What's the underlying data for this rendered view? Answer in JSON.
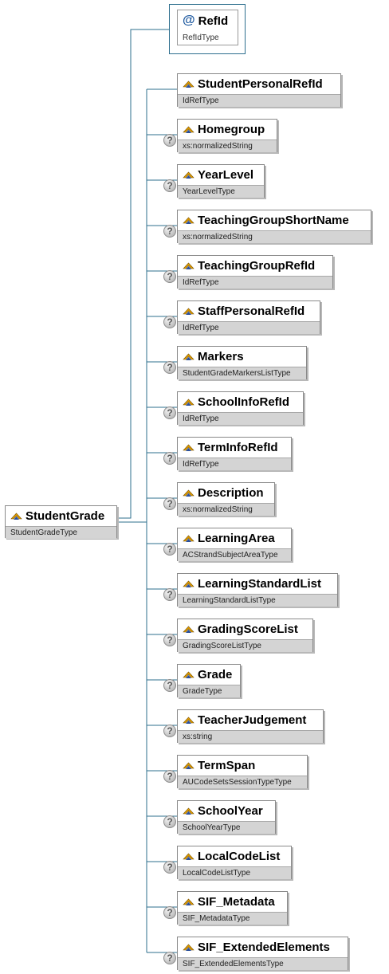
{
  "root": {
    "name": "StudentGrade",
    "type": "StudentGradeType"
  },
  "attribute": {
    "symbol": "@",
    "name": "RefId",
    "type": "RefIdType"
  },
  "optional_icon": "question-mark-icon",
  "element_icon": "element-icon",
  "colors": {
    "connector": "#2e6f8e",
    "type_band": "#d4d4d4",
    "border": "#8a8a8a"
  },
  "elements": [
    {
      "name": "StudentPersonalRefId",
      "type": "IdRefType",
      "optional": false
    },
    {
      "name": "Homegroup",
      "type": "xs:normalizedString",
      "optional": true
    },
    {
      "name": "YearLevel",
      "type": "YearLevelType",
      "optional": true
    },
    {
      "name": "TeachingGroupShortName",
      "type": "xs:normalizedString",
      "optional": true
    },
    {
      "name": "TeachingGroupRefId",
      "type": "IdRefType",
      "optional": true
    },
    {
      "name": "StaffPersonalRefId",
      "type": "IdRefType",
      "optional": true
    },
    {
      "name": "Markers",
      "type": "StudentGradeMarkersListType",
      "optional": true
    },
    {
      "name": "SchoolInfoRefId",
      "type": "IdRefType",
      "optional": true
    },
    {
      "name": "TermInfoRefId",
      "type": "IdRefType",
      "optional": true
    },
    {
      "name": "Description",
      "type": "xs:normalizedString",
      "optional": true
    },
    {
      "name": "LearningArea",
      "type": "ACStrandSubjectAreaType",
      "optional": true
    },
    {
      "name": "LearningStandardList",
      "type": "LearningStandardListType",
      "optional": true
    },
    {
      "name": "GradingScoreList",
      "type": "GradingScoreListType",
      "optional": true
    },
    {
      "name": "Grade",
      "type": "GradeType",
      "optional": true
    },
    {
      "name": "TeacherJudgement",
      "type": "xs:string",
      "optional": true
    },
    {
      "name": "TermSpan",
      "type": "AUCodeSetsSessionTypeType",
      "optional": true
    },
    {
      "name": "SchoolYear",
      "type": "SchoolYearType",
      "optional": true
    },
    {
      "name": "LocalCodeList",
      "type": "LocalCodeListType",
      "optional": true
    },
    {
      "name": "SIF_Metadata",
      "type": "SIF_MetadataType",
      "optional": true
    },
    {
      "name": "SIF_ExtendedElements",
      "type": "SIF_ExtendedElementsType",
      "optional": true
    }
  ]
}
